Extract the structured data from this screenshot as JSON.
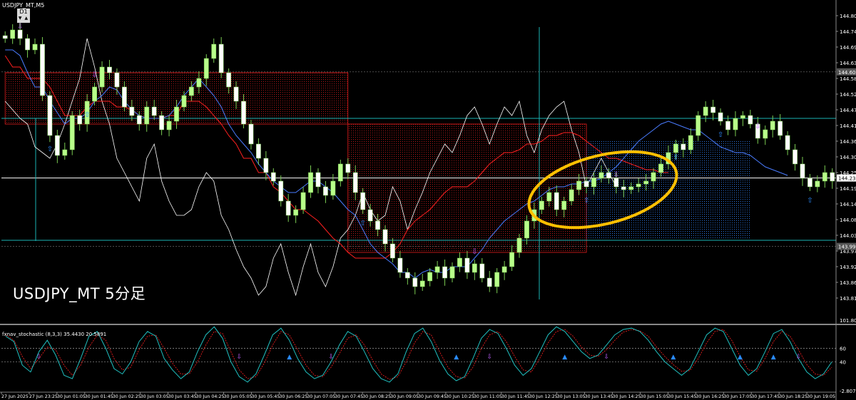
{
  "header": {
    "symbol": "USDJPY_MT,M5",
    "timeframe": "D1",
    "arrows": "▼ ▲"
  },
  "label_text": "USDJPY_MT  5分足",
  "stoch_header": "fxnav_stochastic (8,3,3) 35.4430 20.5891",
  "colors": {
    "background": "#000000",
    "bull": "#b8ff8a",
    "bear": "#ffffff",
    "wick": "#7acc52",
    "kijun": "#ff2020",
    "tenkan": "#4a7cff",
    "chikou": "#ffffff",
    "kumo_bear": "#b01818",
    "kumo_bull": "#2a70d8",
    "crosshair": "#1ab5b5",
    "price_line": "#ffffff",
    "highlight": "#ffc000",
    "stoch_main": "#20c0c0",
    "stoch_signal": "#ff2020",
    "buy_arrow": "#2a8bff",
    "sell_arrow": "#c060ff"
  },
  "chart_data": [
    {
      "type": "candlestick",
      "title": "USDJPY_MT,M5",
      "y_axis_labels": [
        "144.800",
        "144.745",
        "144.690",
        "144.635",
        "144.580",
        "144.525",
        "144.470",
        "144.415",
        "144.360",
        "144.305",
        "144.250",
        "144.195",
        "144.140",
        "144.085",
        "144.030",
        "143.975",
        "143.920",
        "143.865",
        "143.810"
      ],
      "ylim": [
        143.78,
        144.83
      ],
      "current_price": "144.231",
      "price_tags": [
        "144.603",
        "143.991"
      ],
      "x_axis_labels": [
        "27 Jun 2025",
        "27 Jun 23:25",
        "30 Jun 01:05",
        "30 Jun 01:45",
        "30 Jun 02:25",
        "30 Jun 03:05",
        "30 Jun 03:45",
        "30 Jun 04:25",
        "30 Jun 05:05",
        "30 Jun 05:45",
        "30 Jun 06:25",
        "30 Jun 07:05",
        "30 Jun 07:45",
        "30 Jun 08:25",
        "30 Jun 09:05",
        "30 Jun 09:45",
        "30 Jun 10:25",
        "30 Jun 11:05",
        "30 Jun 11:45",
        "30 Jun 12:25",
        "30 Jun 13:05",
        "30 Jun 13:45",
        "30 Jun 14:25",
        "30 Jun 15:05",
        "30 Jun 15:45",
        "30 Jun 16:25",
        "30 Jun 17:05",
        "30 Jun 17:45",
        "30 Jun 18:25",
        "30 Jun 19:05"
      ],
      "close": [
        144.72,
        144.75,
        144.72,
        144.68,
        144.7,
        144.52,
        144.38,
        144.31,
        144.33,
        144.45,
        144.42,
        144.5,
        144.55,
        144.62,
        144.6,
        144.55,
        144.48,
        144.45,
        144.42,
        144.48,
        144.45,
        144.4,
        144.43,
        144.48,
        144.52,
        144.55,
        144.58,
        144.65,
        144.7,
        144.6,
        144.55,
        144.5,
        144.42,
        144.35,
        144.3,
        144.25,
        144.22,
        144.15,
        144.1,
        144.12,
        144.18,
        144.25,
        144.2,
        144.17,
        144.22,
        144.28,
        144.25,
        144.18,
        144.12,
        144.08,
        144.05,
        144.0,
        143.95,
        143.9,
        143.88,
        143.85,
        143.87,
        143.9,
        143.92,
        143.88,
        143.92,
        143.95,
        143.9,
        143.93,
        143.88,
        143.85,
        143.9,
        143.92,
        143.97,
        144.02,
        144.08,
        144.12,
        144.15,
        144.18,
        144.12,
        144.15,
        144.19,
        144.22,
        144.2,
        144.23,
        144.25,
        144.23,
        144.2,
        144.19,
        144.2,
        144.21,
        144.22,
        144.25,
        144.28,
        144.32,
        144.35,
        144.33,
        144.38,
        144.45,
        144.48,
        144.46,
        144.43,
        144.4,
        144.44,
        144.45,
        144.42,
        144.37,
        144.4,
        144.43,
        144.38,
        144.33,
        144.28,
        144.23,
        144.2,
        144.22,
        144.25,
        144.22
      ],
      "tenkan": [
        144.68,
        144.68,
        144.66,
        144.6,
        144.55,
        144.55,
        144.5,
        144.46,
        144.42,
        144.44,
        144.44,
        144.46,
        144.5,
        144.52,
        144.55,
        144.54,
        144.5,
        144.47,
        144.45,
        144.44,
        144.44,
        144.44,
        144.45,
        144.48,
        144.52,
        144.55,
        144.58,
        144.55,
        144.52,
        144.48,
        144.42,
        144.38,
        144.35,
        144.32,
        144.28,
        144.25,
        144.22,
        144.2,
        144.18,
        144.18,
        144.2,
        144.22,
        144.22,
        144.2,
        144.18,
        144.15,
        144.12,
        144.1,
        144.05,
        144.0,
        143.97,
        143.95,
        143.93,
        143.9,
        143.9,
        143.88,
        143.9,
        143.91,
        143.9,
        143.9,
        143.92,
        143.92,
        143.92,
        143.95,
        143.98,
        144.02,
        144.05,
        144.08,
        144.1,
        144.12,
        144.14,
        144.15,
        144.17,
        144.19,
        144.2,
        144.2,
        144.21,
        144.21,
        144.22,
        144.22,
        144.23,
        144.25,
        144.27,
        144.3,
        144.33,
        144.36,
        144.38,
        144.4,
        144.42,
        144.43,
        144.42,
        144.41,
        144.4,
        144.4,
        144.38,
        144.36,
        144.34,
        144.33,
        144.32,
        144.32,
        144.31,
        144.29,
        144.27,
        144.26,
        144.25,
        144.24
      ],
      "kijun": [
        144.66,
        144.62,
        144.62,
        144.58,
        144.58,
        144.58,
        144.55,
        144.5,
        144.45,
        144.45,
        144.45,
        144.48,
        144.5,
        144.5,
        144.5,
        144.48,
        144.48,
        144.47,
        144.45,
        144.44,
        144.44,
        144.44,
        144.45,
        144.45,
        144.5,
        144.5,
        144.5,
        144.48,
        144.45,
        144.42,
        144.38,
        144.35,
        144.3,
        144.3,
        144.25,
        144.25,
        144.2,
        144.18,
        144.15,
        144.12,
        144.12,
        144.1,
        144.08,
        144.05,
        144.02,
        144.0,
        143.97,
        143.95,
        143.95,
        143.95,
        143.95,
        143.95,
        143.97,
        144.0,
        144.05,
        144.08,
        144.1,
        144.12,
        144.15,
        144.18,
        144.2,
        144.2,
        144.2,
        144.22,
        144.25,
        144.28,
        144.3,
        144.32,
        144.32,
        144.33,
        144.35,
        144.35,
        144.36,
        144.38,
        144.38,
        144.39,
        144.39,
        144.38,
        144.36,
        144.34,
        144.32,
        144.3,
        144.3,
        144.29,
        144.28,
        144.27,
        144.26,
        144.26,
        144.25,
        144.25
      ],
      "chikou": [
        144.5,
        144.47,
        144.44,
        144.42,
        144.34,
        144.32,
        144.3,
        144.35,
        144.42,
        144.5,
        144.58,
        144.72,
        144.62,
        144.5,
        144.42,
        144.3,
        144.25,
        144.2,
        144.15,
        144.3,
        144.35,
        144.22,
        144.15,
        144.1,
        144.1,
        144.12,
        144.2,
        144.25,
        144.22,
        144.1,
        144.05,
        143.98,
        143.92,
        143.88,
        143.82,
        143.85,
        143.95,
        144.0,
        143.9,
        143.82,
        143.92,
        144.0,
        143.9,
        143.85,
        143.92,
        144.02,
        144.05,
        144.1,
        144.18,
        144.12,
        144.08,
        144.1,
        144.2,
        144.15,
        144.05,
        144.12,
        144.18,
        144.25,
        144.3,
        144.35,
        144.32,
        144.38,
        144.45,
        144.48,
        144.42,
        144.35,
        144.42,
        144.48,
        144.45,
        144.5,
        144.38,
        144.32,
        144.4,
        144.45,
        144.48,
        144.5,
        144.4,
        144.32,
        144.2,
        144.25,
        144.3,
        144.25,
        144.2
      ],
      "kumo_spans": [
        {
          "from": 0,
          "to": 46,
          "upper": 144.6,
          "lower": 144.42,
          "color": "kumo_bear"
        },
        {
          "from": 46,
          "to": 78,
          "upper": 144.42,
          "lower": 143.97,
          "color": "kumo_bear"
        },
        {
          "from": 78,
          "to": 100,
          "upper": 144.36,
          "lower": 144.02,
          "color": "kumo_bull"
        }
      ],
      "buy_arrows": [
        6,
        11,
        48,
        78,
        90,
        96,
        108
      ],
      "sell_arrows": [
        2,
        12,
        63,
        82,
        101
      ],
      "annotation": "yellow ellipse around price consolidation above bullish cloud, 30 Jun 11:45-14:25"
    },
    {
      "type": "line",
      "title": "fxnav_stochastic (8,3,3)",
      "y_axis_labels": [
        "101.8012",
        "60",
        "40",
        "-2.8073"
      ],
      "ylim": [
        -2.8073,
        101.8012
      ],
      "levels": [
        60,
        40
      ],
      "series": [
        {
          "values": [
            78,
            70,
            35,
            25,
            55,
            72,
            50,
            20,
            15,
            45,
            78,
            85,
            60,
            30,
            22,
            40,
            70,
            85,
            78,
            45,
            28,
            15,
            25,
            55,
            80,
            92,
            75,
            40,
            18,
            10,
            22,
            50,
            80,
            90,
            72,
            45,
            25,
            15,
            20,
            40,
            65,
            85,
            78,
            55,
            30,
            15,
            10,
            22,
            55,
            82,
            90,
            70,
            42,
            22,
            12,
            18,
            45,
            75,
            88,
            82,
            60,
            35,
            20,
            30,
            55,
            80,
            92,
            85,
            70,
            55,
            45,
            50,
            65,
            80,
            88,
            90,
            85,
            72,
            55,
            40,
            30,
            20,
            30,
            55,
            80,
            90,
            85,
            60,
            35,
            20,
            30,
            55,
            82,
            88,
            70,
            45,
            25,
            15,
            22,
            40
          ]
        },
        {
          "values": [
            80,
            72,
            48,
            30,
            45,
            62,
            58,
            35,
            20,
            35,
            62,
            80,
            72,
            45,
            28,
            32,
            58,
            78,
            80,
            60,
            38,
            22,
            22,
            40,
            65,
            85,
            82,
            55,
            28,
            15,
            18,
            38,
            65,
            85,
            80,
            58,
            35,
            20,
            18,
            32,
            52,
            75,
            80,
            65,
            42,
            22,
            14,
            18,
            40,
            68,
            85,
            80,
            55,
            32,
            18,
            16,
            32,
            60,
            80,
            85,
            70,
            48,
            28,
            25,
            45,
            68,
            85,
            88,
            78,
            62,
            50,
            48,
            58,
            72,
            84,
            88,
            86,
            78,
            62,
            48,
            36,
            26,
            27,
            45,
            68,
            85,
            88,
            72,
            48,
            28,
            26,
            45,
            70,
            85,
            78,
            58,
            36,
            22,
            20,
            32
          ]
        }
      ]
    }
  ]
}
